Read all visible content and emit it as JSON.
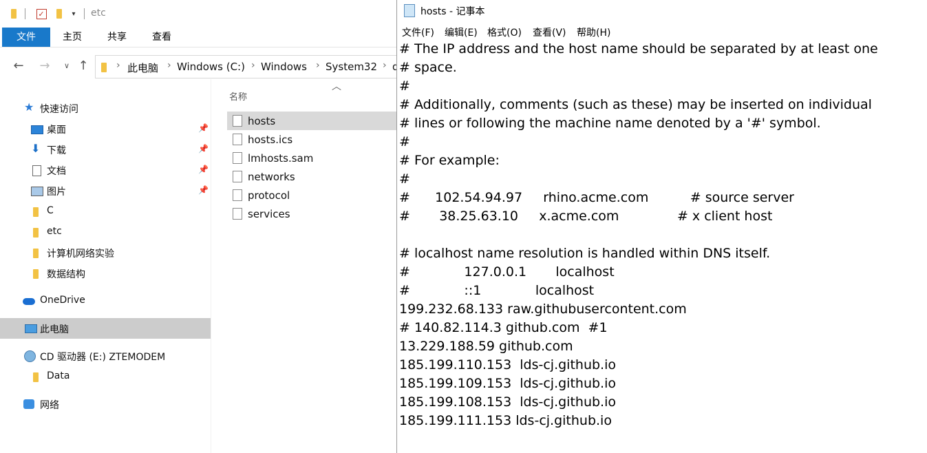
{
  "explorer": {
    "title": "etc",
    "ribbon_tabs": [
      "文件",
      "主页",
      "共享",
      "查看"
    ],
    "breadcrumb": [
      "此电脑",
      "Windows (C:)",
      "Windows",
      "System32",
      "d"
    ],
    "nav_items": [
      {
        "label": "快速访问",
        "icon": "star-icon"
      },
      {
        "label": "桌面",
        "icon": "desktop-icon",
        "pinned": true
      },
      {
        "label": "下载",
        "icon": "download-icon",
        "pinned": true
      },
      {
        "label": "文档",
        "icon": "document-icon",
        "pinned": true
      },
      {
        "label": "图片",
        "icon": "pictures-icon",
        "pinned": true
      },
      {
        "label": "C",
        "icon": "folder-icon"
      },
      {
        "label": "etc",
        "icon": "folder-icon"
      },
      {
        "label": "计算机网络实验",
        "icon": "folder-icon"
      },
      {
        "label": "数据结构",
        "icon": "folder-icon"
      },
      {
        "label": "OneDrive",
        "icon": "cloud-icon"
      },
      {
        "label": "此电脑",
        "icon": "computer-icon",
        "selected": true
      },
      {
        "label": "CD 驱动器 (E:) ZTEMODEM",
        "icon": "cd-drive-icon"
      },
      {
        "label": "Data",
        "icon": "folder-icon"
      },
      {
        "label": "网络",
        "icon": "network-icon"
      }
    ],
    "column_header": "名称",
    "files": [
      {
        "name": "hosts",
        "selected": true
      },
      {
        "name": "hosts.ics"
      },
      {
        "name": "lmhosts.sam"
      },
      {
        "name": "networks"
      },
      {
        "name": "protocol"
      },
      {
        "name": "services"
      }
    ]
  },
  "notepad": {
    "title": "hosts - 记事本",
    "menu": [
      "文件(F)",
      "编辑(E)",
      "格式(O)",
      "查看(V)",
      "帮助(H)"
    ],
    "lines": [
      "# The IP address and the host name should be separated by at least one",
      "# space.",
      "#",
      "# Additionally, comments (such as these) may be inserted on individual",
      "# lines or following the machine name denoted by a '#' symbol.",
      "#",
      "# For example:",
      "#",
      "#      102.54.94.97     rhino.acme.com          # source server",
      "#       38.25.63.10     x.acme.com              # x client host",
      "",
      "# localhost name resolution is handled within DNS itself.",
      "#             127.0.0.1       localhost",
      "#             ::1             localhost",
      "199.232.68.133 raw.githubusercontent.com",
      "# 140.82.114.3 github.com  #1",
      "13.229.188.59 github.com",
      "185.199.110.153  lds-cj.github.io",
      "185.199.109.153  lds-cj.github.io",
      "185.199.108.153  lds-cj.github.io",
      "185.199.111.153 lds-cj.github.io"
    ]
  }
}
